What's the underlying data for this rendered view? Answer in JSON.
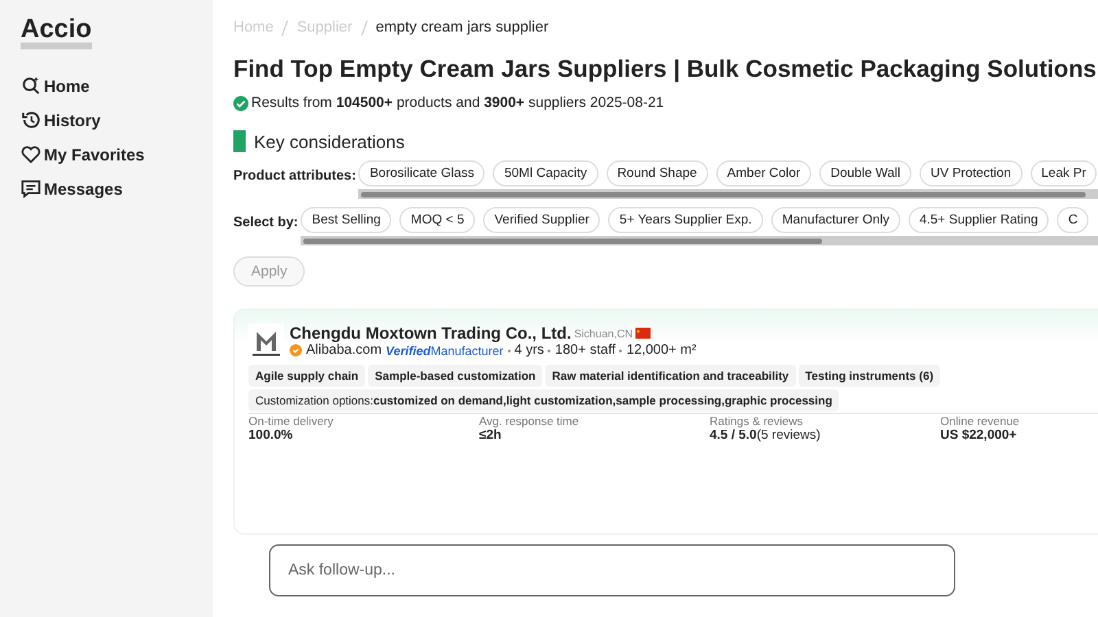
{
  "sidebar": {
    "logo": "Accio",
    "items": [
      {
        "label": "Home"
      },
      {
        "label": "History"
      },
      {
        "label": "My Favorites"
      },
      {
        "label": "Messages"
      }
    ]
  },
  "breadcrumb": [
    {
      "label": "Home",
      "current": false
    },
    {
      "label": "Supplier",
      "current": false
    },
    {
      "label": "empty cream jars supplier",
      "current": true
    }
  ],
  "title": "Find Top Empty Cream Jars Suppliers | Bulk Cosmetic Packaging Solutions",
  "results_note": "Results from **104500+** products and **3900+** suppliers 2025-08-21",
  "key_considerations": {
    "heading": "Key considerations",
    "filter_rows": [
      {
        "label": "Product attributes:",
        "chips": [
          "Borosilicate Glass",
          "50Ml Capacity",
          "Round Shape",
          "Amber Color",
          "Double Wall",
          "UV Protection",
          "Leak Pr"
        ]
      },
      {
        "label": "Select by:",
        "chips": [
          "Best Selling",
          "MOQ < 5",
          "Verified Supplier",
          "5+ Years Supplier Exp.",
          "Manufacturer Only",
          "4.5+ Supplier Rating",
          "C"
        ]
      }
    ],
    "apply_button": {
      "label": "Apply",
      "disabled": true
    }
  },
  "supplier_card": {
    "name": "Chengdu Moxtown Trading Co., Ltd.",
    "location": "Sichuan,CN",
    "platform": "Alibaba.com",
    "verified": "Verified",
    "business_type": "Manufacturer",
    "facts": [
      "4 yrs",
      "180+ staff",
      "12,000+ m²"
    ],
    "tags": [
      "Agile supply chain",
      "Sample-based customization",
      "Raw material identification and traceability",
      "Testing instruments (6)"
    ],
    "customization_label": "Customization options:",
    "customization_value": "customized on demand,light customization,sample processing,graphic processing",
    "stats": [
      {
        "label": "On-time delivery",
        "value": "100.0%"
      },
      {
        "label": "Avg. response time",
        "value": "≤2h"
      },
      {
        "label": "Ratings & reviews",
        "value": "4.5 / 5.0",
        "extra": "(5 reviews)"
      },
      {
        "label": "Online revenue",
        "value": "US $22,000+"
      }
    ]
  },
  "follow_up": {
    "placeholder": "Ask follow-up..."
  }
}
